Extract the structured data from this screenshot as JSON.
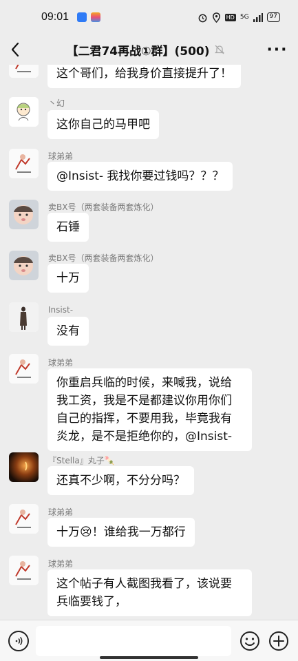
{
  "status_bar": {
    "time": "09:01",
    "network": "5G",
    "battery": "97",
    "icons": [
      "alarm-icon",
      "location-icon",
      "hd-icon",
      "signal-icon",
      "battery-icon"
    ]
  },
  "nav": {
    "title": "【二君74再战①群】(500)",
    "more": "···"
  },
  "messages": [
    {
      "sender": "",
      "text": "这个哥们，给我身价直接提升了！",
      "avatar": "cartoon-chair"
    },
    {
      "sender": "丶幻",
      "text": "这你自己的马甲吧",
      "avatar": "cartoon-girl"
    },
    {
      "sender": "球弟弟",
      "text": "@Insist-  我找你要过钱吗？？？",
      "avatar": "cartoon-chair"
    },
    {
      "sender": "卖BX号（两套装备两套炼化）",
      "text": "石锤",
      "avatar": "baby-photo"
    },
    {
      "sender": "卖BX号（两套装备两套炼化）",
      "text": "十万",
      "avatar": "baby-photo"
    },
    {
      "sender": "Insist-",
      "text": "没有",
      "avatar": "figure-photo"
    },
    {
      "sender": "球弟弟",
      "text": "你重启兵临的时候，来喊我，说给我工资，我是不是都建议你用你们自己的指挥，不要用我，毕竟我有炎龙，是不是拒绝你的，@Insist-",
      "avatar": "cartoon-chair"
    },
    {
      "sender": "『Stella』丸子🍡",
      "text": "还真不少啊，不分分吗？",
      "avatar": "candle-photo"
    },
    {
      "sender": "球弟弟",
      "text": "十万😢！谁给我一万都行",
      "avatar": "cartoon-chair"
    },
    {
      "sender": "球弟弟",
      "text": "这个帖子有人截图我看了，该说要兵临要钱了，",
      "avatar": "cartoon-chair"
    }
  ],
  "input": {
    "placeholder": ""
  },
  "colors": {
    "background": "#ededed",
    "bubble": "#ffffff",
    "sender": "#7a7a7a"
  }
}
